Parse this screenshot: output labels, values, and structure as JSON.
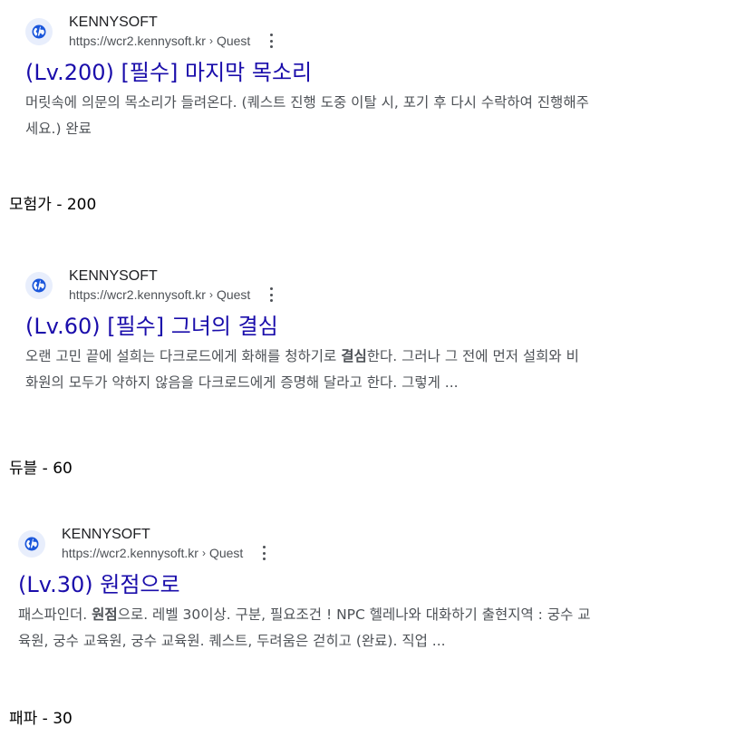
{
  "results": [
    {
      "site_name": "KENNYSOFT",
      "url_base": "https://wcr2.kennysoft.kr",
      "url_sep": "›",
      "url_path": "Quest",
      "title": "(Lv.200) [필수] 마지막 목소리",
      "snippet_line1": "머릿속에 의문의 목소리가 들려온다. (퀘스트 진행 도중 이탈 시, 포기 후 다시 수락하여 진행해주",
      "snippet_line2": "세요.) 완료",
      "caption": "모험가 - 200"
    },
    {
      "site_name": "KENNYSOFT",
      "url_base": "https://wcr2.kennysoft.kr",
      "url_sep": "›",
      "url_path": "Quest",
      "title": "(Lv.60) [필수] 그녀의 결심",
      "snippet_line1_pre": "오랜 고민 끝에 설희는 다크로드에게 화해를 청하기로 ",
      "snippet_line1_bold": "결심",
      "snippet_line1_post": "한다. 그러나 그 전에 먼저 설희와 비",
      "snippet_line2": "화원의 모두가 약하지 않음을 다크로드에게 증명해 달라고 한다. 그렇게 ...",
      "caption": "듀블 - 60"
    },
    {
      "site_name": "KENNYSOFT",
      "url_base": "https://wcr2.kennysoft.kr",
      "url_sep": "›",
      "url_path": "Quest",
      "title": "(Lv.30) 원점으로",
      "snippet_line1_pre": "패스파인더. ",
      "snippet_line1_bold": "원점",
      "snippet_line1_post": "으로. 레벨 30이상. 구분, 필요조건 ! NPC 헬레나와 대화하기 출현지역 : 궁수 교",
      "snippet_line2": "육원, 궁수 교육원, 궁수 교육원. 퀘스트, 두려움은 걷히고 (완료). 직업 ...",
      "caption": "패파 - 30"
    }
  ],
  "colors": {
    "title_link": "#1a0dab",
    "snippet_text": "#4d5156",
    "favicon_bg": "#e8eefc",
    "favicon_globe": "#1a56db"
  },
  "icons": {
    "favicon": "globe-icon",
    "menu": "more-vert-icon"
  }
}
